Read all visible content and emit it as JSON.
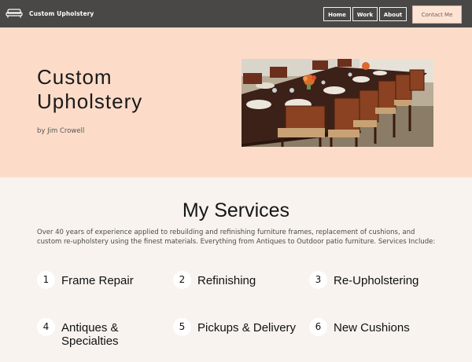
{
  "nav": {
    "brand": "Custom Upholstery",
    "brand_icon": "sofa-icon",
    "links": [
      "Home",
      "Work",
      "About"
    ],
    "cta": "Contact Me"
  },
  "hero": {
    "title_line1": "Custom",
    "title_line2": "Upholstery",
    "byline": "by Jim Crowell",
    "image_alt": "Dining table with upholstered chairs"
  },
  "services": {
    "title": "My Services",
    "description": "Over 40 years of experience applied to rebuilding and refinishing furniture frames, replacement of cushions, and custom re-upholstery using the finest materials. Everything from Antiques to Outdoor patio furniture. Services Include:",
    "items": [
      {
        "num": "1",
        "label": "Frame Repair"
      },
      {
        "num": "2",
        "label": "Refinishing"
      },
      {
        "num": "3",
        "label": "Re-Upholstering"
      },
      {
        "num": "4",
        "label": "Antiques & Specialties"
      },
      {
        "num": "5",
        "label": "Pickups & Delivery"
      },
      {
        "num": "6",
        "label": "New Cushions"
      }
    ]
  },
  "colors": {
    "nav_bg": "#4a4847",
    "hero_bg": "#fcdcc9",
    "page_bg": "#f8f3ef",
    "cta_bg": "#fde3d4"
  }
}
